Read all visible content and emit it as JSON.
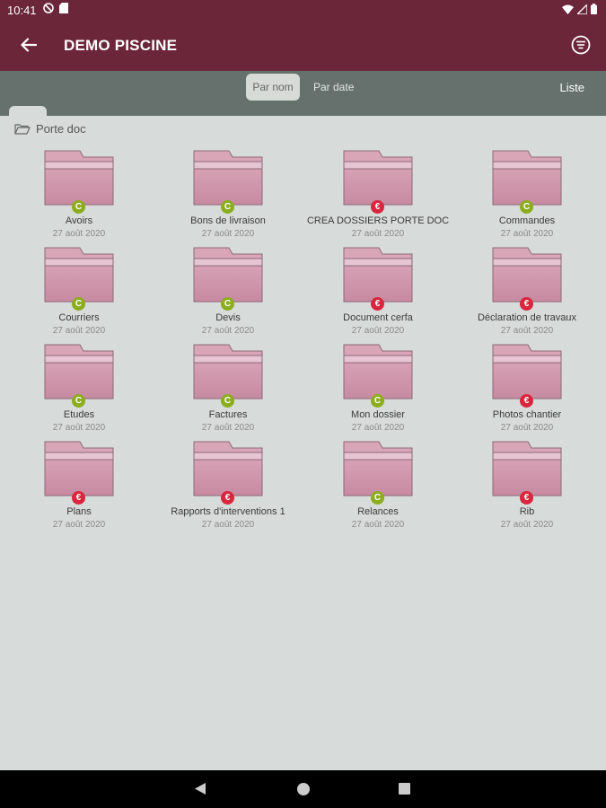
{
  "status": {
    "time": "10:41"
  },
  "app": {
    "title": "DEMO PISCINE"
  },
  "sort": {
    "by_name": "Par nom",
    "by_date": "Par date",
    "list": "Liste"
  },
  "breadcrumb": {
    "label": "Porte doc"
  },
  "colors": {
    "accent": "#6b2639",
    "folder": "#d9a3b7",
    "badge_green": "#8cad1e",
    "badge_red": "#d7263d"
  },
  "folders": [
    {
      "name": "Avoirs",
      "date": "27 août 2020",
      "badge": "C",
      "badge_color": "green"
    },
    {
      "name": "Bons de livraison",
      "date": "27 août 2020",
      "badge": "C",
      "badge_color": "green"
    },
    {
      "name": "CREA DOSSIERS PORTE DOC",
      "date": "27 août 2020",
      "badge": "€",
      "badge_color": "red"
    },
    {
      "name": "Commandes",
      "date": "27 août 2020",
      "badge": "C",
      "badge_color": "green"
    },
    {
      "name": "Courriers",
      "date": "27 août 2020",
      "badge": "C",
      "badge_color": "green"
    },
    {
      "name": "Devis",
      "date": "27 août 2020",
      "badge": "C",
      "badge_color": "green"
    },
    {
      "name": "Document cerfa",
      "date": "27 août 2020",
      "badge": "€",
      "badge_color": "red"
    },
    {
      "name": "Déclaration de travaux",
      "date": "27 août 2020",
      "badge": "€",
      "badge_color": "red"
    },
    {
      "name": "Etudes",
      "date": "27 août 2020",
      "badge": "C",
      "badge_color": "green"
    },
    {
      "name": "Factures",
      "date": "27 août 2020",
      "badge": "C",
      "badge_color": "green"
    },
    {
      "name": "Mon dossier",
      "date": "27 août 2020",
      "badge": "C",
      "badge_color": "green"
    },
    {
      "name": "Photos chantier",
      "date": "27 août 2020",
      "badge": "€",
      "badge_color": "red"
    },
    {
      "name": "Plans",
      "date": "27 août 2020",
      "badge": "€",
      "badge_color": "red"
    },
    {
      "name": "Rapports d'interventions 1",
      "date": "27 août 2020",
      "badge": "€",
      "badge_color": "red"
    },
    {
      "name": "Relances",
      "date": "27 août 2020",
      "badge": "C",
      "badge_color": "green"
    },
    {
      "name": "Rib",
      "date": "27 août 2020",
      "badge": "€",
      "badge_color": "red"
    }
  ]
}
